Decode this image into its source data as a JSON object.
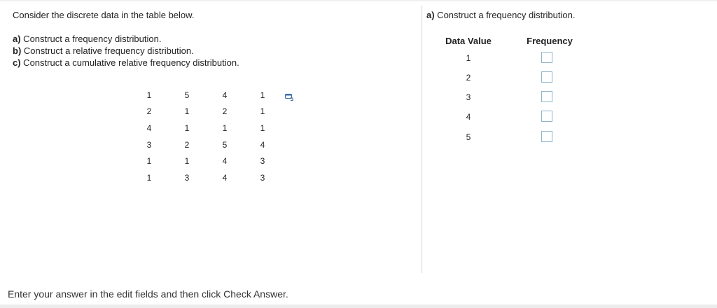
{
  "question": {
    "intro": "Consider the discrete data in the table below.",
    "tasks": [
      {
        "letter": "a)",
        "text": " Construct a frequency distribution."
      },
      {
        "letter": "b)",
        "text": " Construct a relative frequency distribution."
      },
      {
        "letter": "c)",
        "text": " Construct a cumulative relative frequency distribution."
      }
    ],
    "table": [
      [
        "1",
        "5",
        "4",
        "1"
      ],
      [
        "2",
        "1",
        "2",
        "1"
      ],
      [
        "4",
        "1",
        "1",
        "1"
      ],
      [
        "3",
        "2",
        "5",
        "4"
      ],
      [
        "1",
        "1",
        "4",
        "3"
      ],
      [
        "1",
        "3",
        "4",
        "3"
      ]
    ],
    "copy_icon": "copy-data-icon"
  },
  "answer": {
    "title_letter": "a)",
    "title_text": " Construct a frequency distribution.",
    "col_value": "Data Value",
    "col_frequency": "Frequency",
    "rows": [
      {
        "value": "1",
        "frequency": ""
      },
      {
        "value": "2",
        "frequency": ""
      },
      {
        "value": "3",
        "frequency": ""
      },
      {
        "value": "4",
        "frequency": ""
      },
      {
        "value": "5",
        "frequency": ""
      }
    ]
  },
  "footer": {
    "instruction": "Enter your answer in the edit fields and then click Check Answer."
  },
  "colors": {
    "input_border": "#8fb3c8",
    "icon_blue": "#3a6ea5",
    "divider": "#d6d6d6"
  }
}
